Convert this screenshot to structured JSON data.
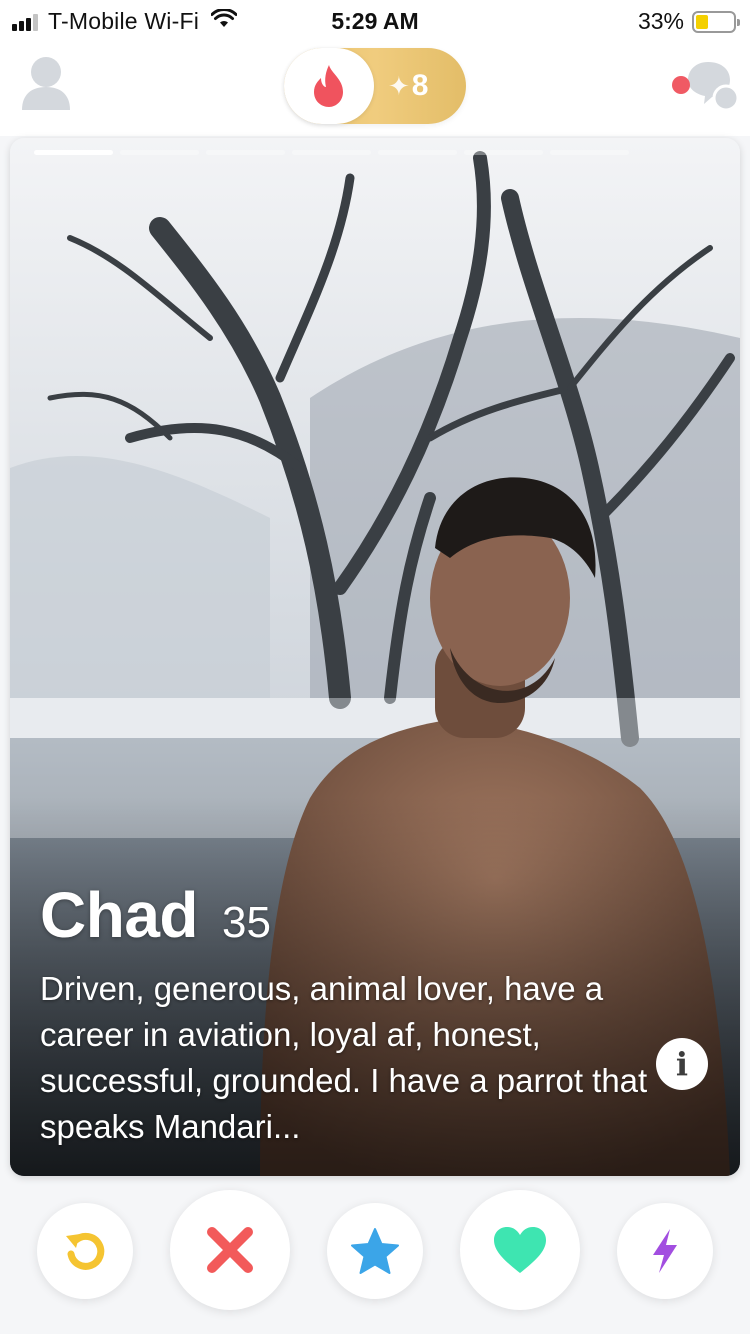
{
  "status_bar": {
    "carrier": "T-Mobile Wi-Fi",
    "time": "5:29 AM",
    "battery_percent": "33%",
    "battery_level": 0.33
  },
  "top_nav": {
    "boost_count": "8",
    "icons": [
      "profile-icon",
      "flame-icon",
      "sparkle-icon",
      "chat-bubbles-icon"
    ],
    "colors": {
      "flame": "#f0535e",
      "pill": "#ecc674",
      "notification_dot": "#f05a64"
    }
  },
  "card": {
    "name": "Chad",
    "age": "35",
    "bio": "Driven, generous, animal lover, have a career in aviation, loyal af, honest, successful, grounded. I have a parrot that speaks Mandari...",
    "photo_count": 7,
    "active_photo": 1,
    "info_label": "i"
  },
  "actions": [
    {
      "name": "rewind",
      "icon": "rewind-icon",
      "color": "#f5c431"
    },
    {
      "name": "nope",
      "icon": "x-icon",
      "color": "#f25a5a"
    },
    {
      "name": "super-like",
      "icon": "star-icon",
      "color": "#3ba5e8"
    },
    {
      "name": "like",
      "icon": "heart-icon",
      "color": "#3ee5b1"
    },
    {
      "name": "boost",
      "icon": "lightning-icon",
      "color": "#a24ee0"
    }
  ]
}
